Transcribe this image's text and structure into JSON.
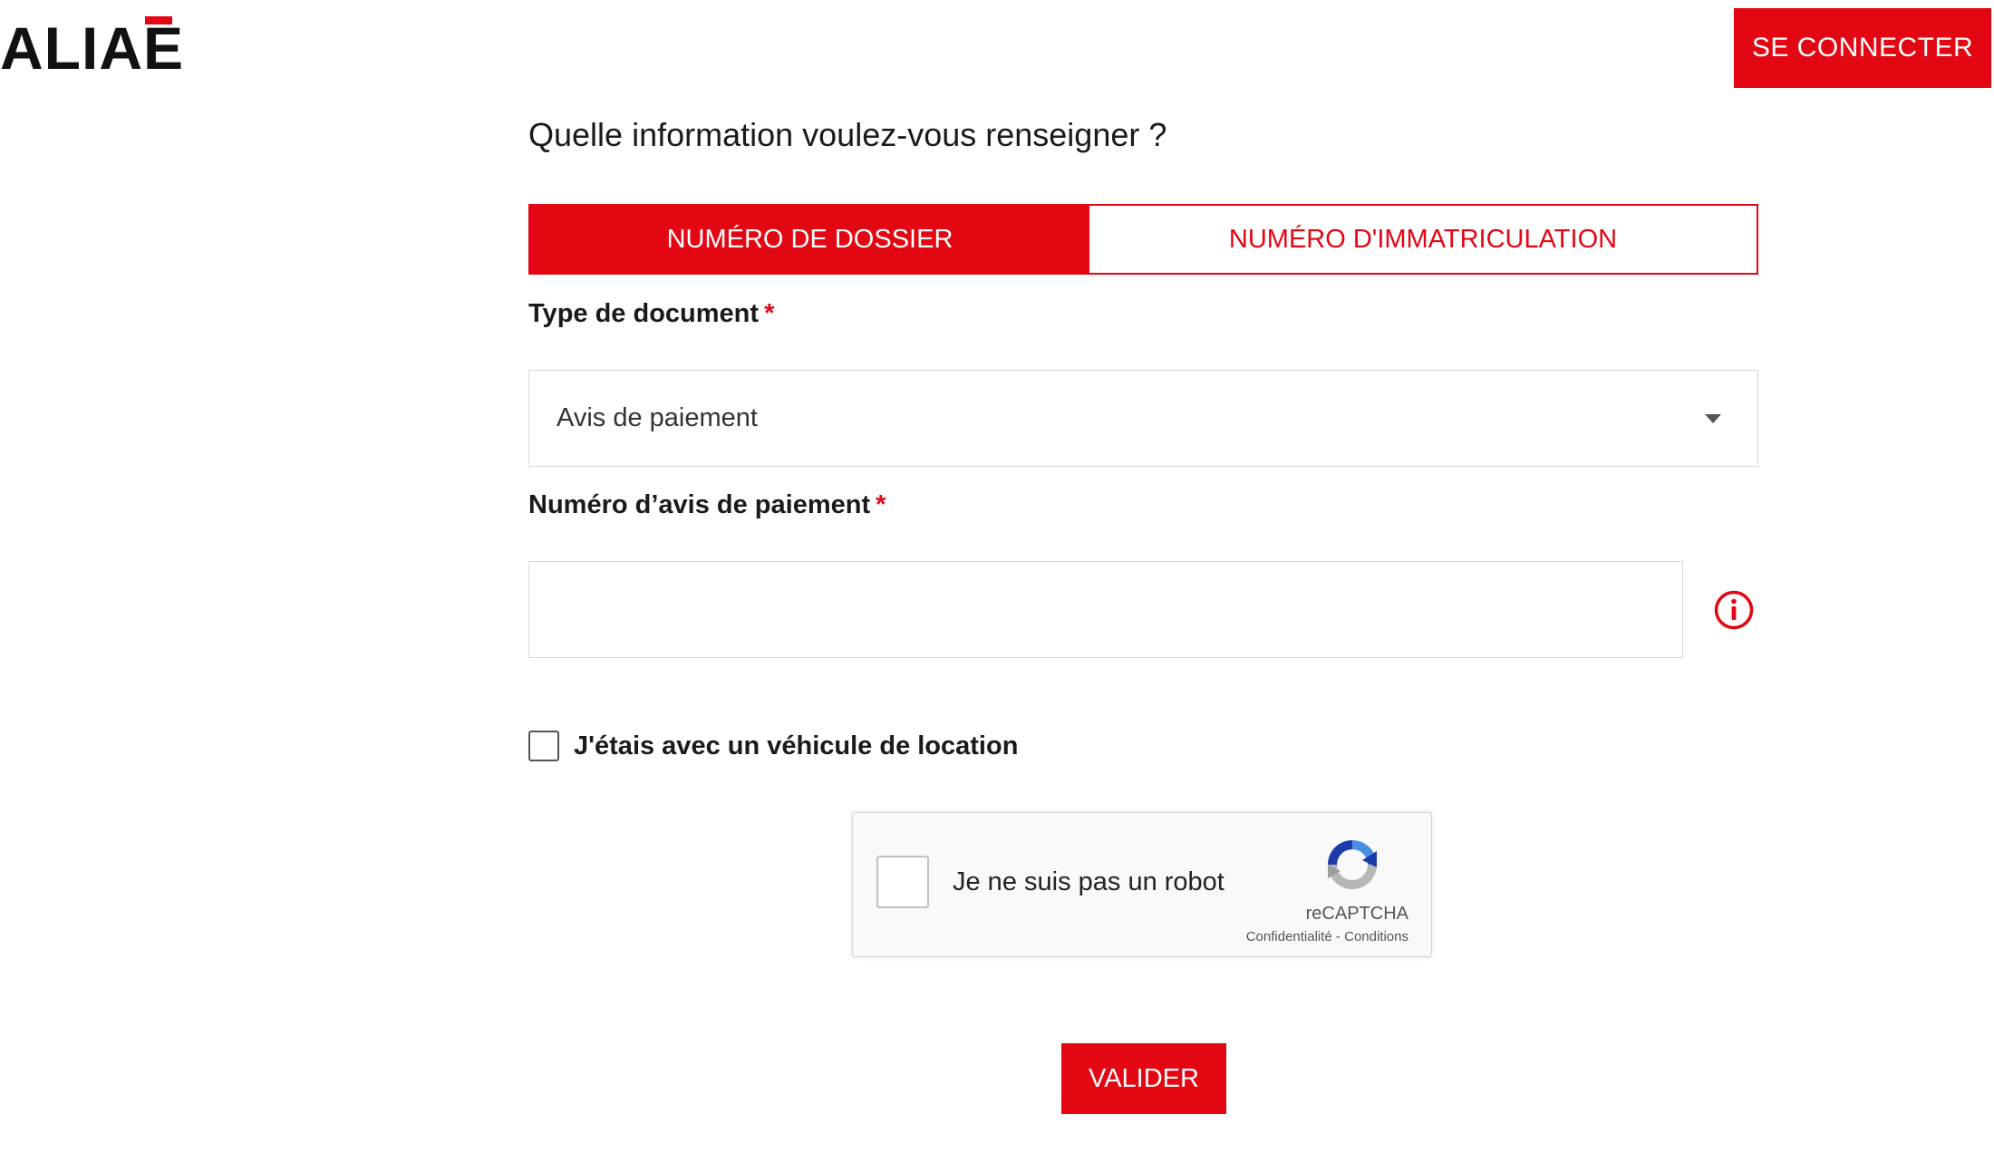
{
  "header": {
    "logo_text": "ALIAE",
    "connect_label": "SE CONNECTER"
  },
  "form": {
    "question": "Quelle information voulez-vous renseigner ?",
    "tabs": [
      {
        "label": "NUMÉRO DE DOSSIER",
        "active": true
      },
      {
        "label": "NUMÉRO D'IMMATRICULATION",
        "active": false
      }
    ],
    "document_type": {
      "label": "Type de document",
      "required_mark": "*",
      "selected": "Avis de paiement"
    },
    "notice_number": {
      "label": "Numéro d’avis de paiement",
      "required_mark": "*",
      "value": ""
    },
    "rental_checkbox": {
      "label": "J'étais avec un véhicule de location",
      "checked": false
    },
    "submit_label": "VALIDER"
  },
  "recaptcha": {
    "text": "Je ne suis pas un robot",
    "brand": "reCAPTCHA",
    "privacy": "Confidentialité",
    "separator": " - ",
    "terms": "Conditions"
  },
  "colors": {
    "accent": "#e30613",
    "border": "#d9d9d9",
    "text": "#1a1a1a"
  },
  "icons": {
    "dropdown": "chevron-down-icon",
    "info": "info-icon",
    "recaptcha": "recaptcha-logo-icon"
  }
}
